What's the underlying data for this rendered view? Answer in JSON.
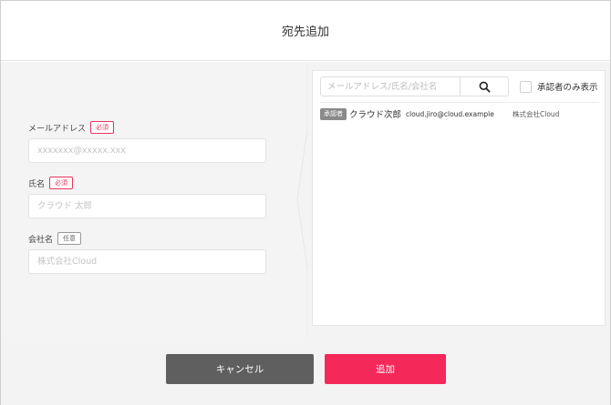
{
  "header": {
    "title": "宛先追加"
  },
  "form": {
    "email": {
      "label": "メールアドレス",
      "badge": "必須",
      "placeholder": "xxxxxxx@xxxxx.xxx",
      "value": ""
    },
    "name": {
      "label": "氏名",
      "badge": "必須",
      "placeholder": "クラウド 太郎",
      "value": ""
    },
    "company": {
      "label": "会社名",
      "badge": "任意",
      "placeholder": "株式会社Cloud",
      "value": ""
    }
  },
  "list": {
    "search": {
      "placeholder": "メールアドレス/氏名/会社名",
      "value": "",
      "icon": "search-icon"
    },
    "approver_filter": {
      "label": "承認者のみ表示",
      "checked": false
    },
    "rows": [
      {
        "tag": "承認者",
        "name": "クラウド次郎",
        "email": "cloud.jiro@cloud.example",
        "company": "株式会社Cloud"
      }
    ]
  },
  "footer": {
    "cancel_label": "キャンセル",
    "add_label": "追加"
  },
  "colors": {
    "accent": "#f5285a",
    "required_badge": "#e8365d",
    "cancel_button": "#5f5f5f",
    "tag_bg": "#8a8a8a"
  }
}
